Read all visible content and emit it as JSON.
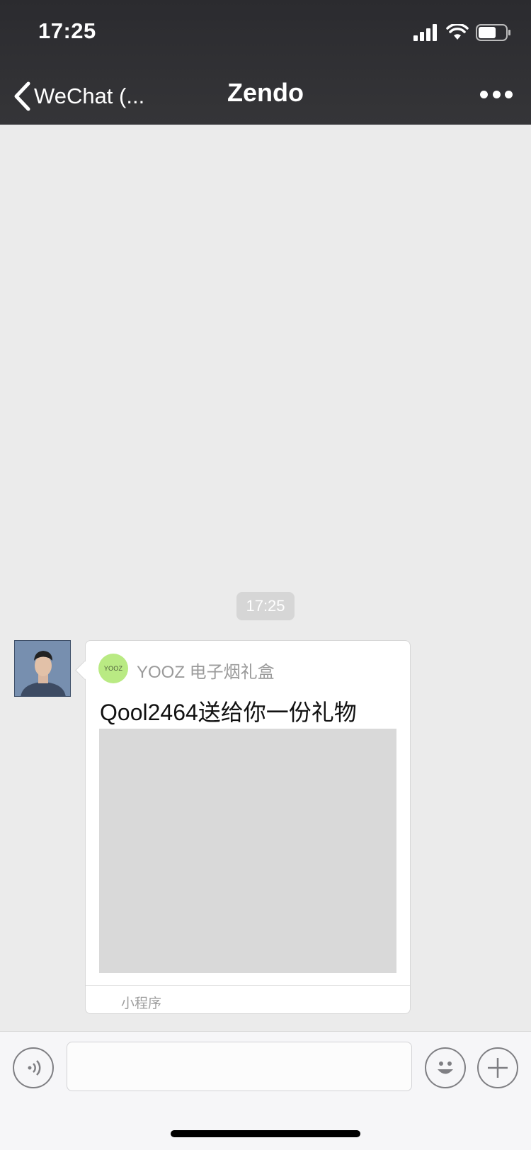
{
  "status_bar": {
    "time": "17:25"
  },
  "nav": {
    "back_label": "WeChat (...",
    "title": "Zendo"
  },
  "chat": {
    "timestamp": "17:25",
    "message": {
      "app_icon_text": "YOOZ",
      "app_name": "YOOZ 电子烟礼盒",
      "title": "Qool2464送给你一份礼物",
      "footer_label": "小程序"
    }
  },
  "colors": {
    "navbar": "#2b2b2f",
    "chat_background": "#ebebeb",
    "app_icon": "#b9ea83"
  },
  "icons": [
    "signal-icon",
    "wifi-icon",
    "battery-icon",
    "back-chevron-icon",
    "more-icon",
    "voice-icon",
    "emoji-icon",
    "plus-icon"
  ]
}
